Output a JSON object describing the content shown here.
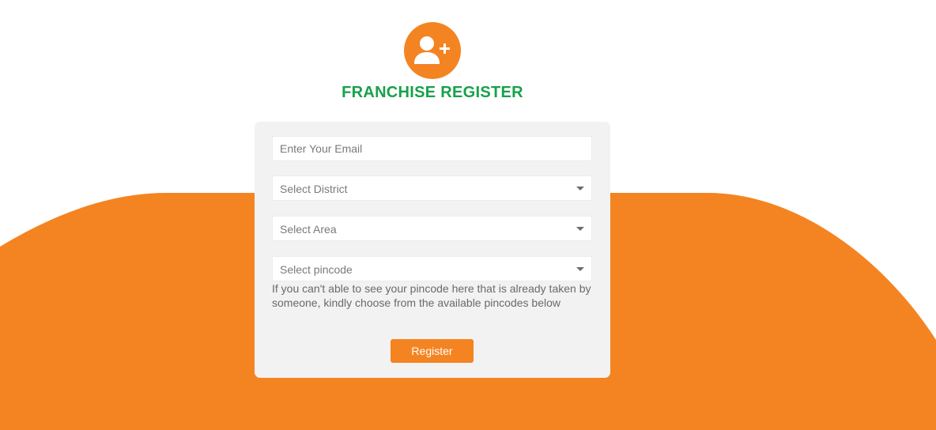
{
  "colors": {
    "accent": "#f48422",
    "title": "#17a14a",
    "card": "#f2f2f2"
  },
  "header": {
    "icon": "user-plus-icon",
    "title": "FRANCHISE REGISTER"
  },
  "form": {
    "email": {
      "placeholder": "Enter Your Email",
      "value": ""
    },
    "district": {
      "selected": "Select District",
      "icon": "chevron-down-icon"
    },
    "area": {
      "selected": "Select Area",
      "icon": "chevron-down-icon"
    },
    "pincode": {
      "selected": "Select pincode",
      "icon": "chevron-down-icon"
    },
    "note": "If you can't able to see your pincode here that is already taken by someone, kindly choose from the available pincodes below",
    "submit_label": "Register"
  }
}
